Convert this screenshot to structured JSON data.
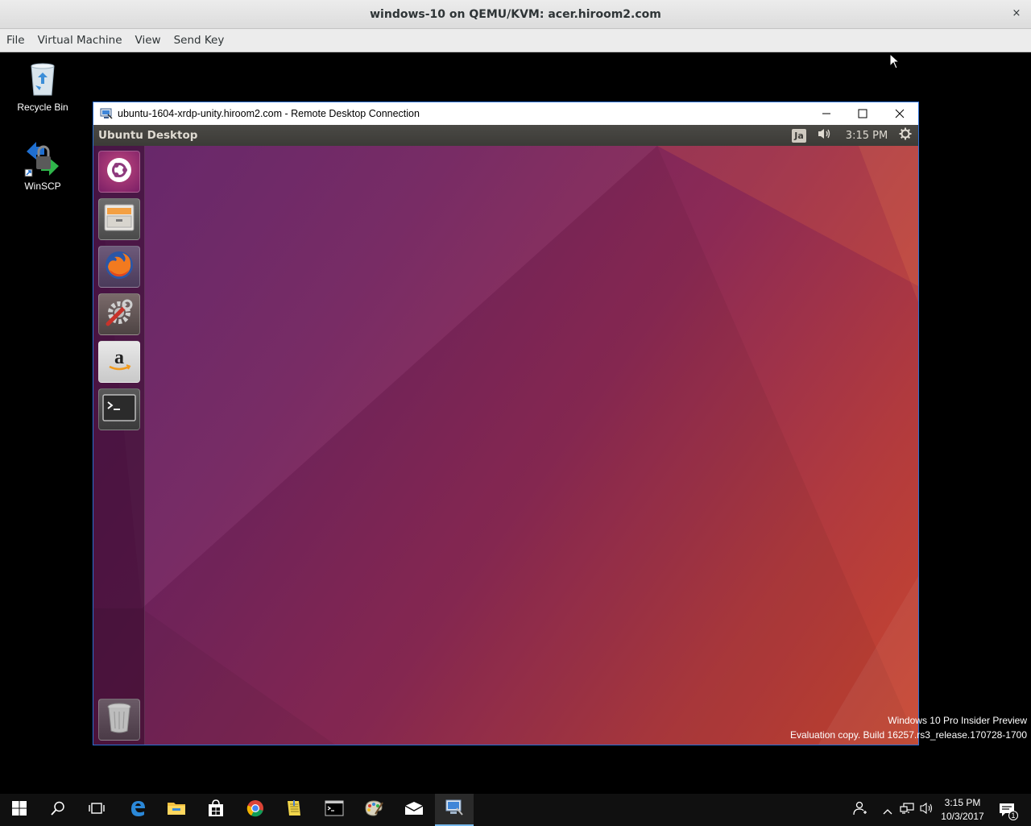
{
  "host": {
    "title": "windows-10 on QEMU/KVM: acer.hiroom2.com",
    "close_glyph": "×",
    "menu": [
      "File",
      "Virtual Machine",
      "View",
      "Send Key"
    ]
  },
  "desktop": {
    "icons": [
      {
        "label": "Recycle Bin",
        "icon": "recycle-bin-icon"
      },
      {
        "label": "WinSCP",
        "icon": "winscp-icon"
      }
    ],
    "watermark": {
      "line1": "Windows 10 Pro Insider Preview",
      "line2": "Evaluation copy. Build 16257.rs3_release.170728-1700"
    }
  },
  "rdp_window": {
    "title": "ubuntu-1604-xrdp-unity.hiroom2.com - Remote Desktop Connection",
    "controls": [
      "minimize-icon",
      "maximize-icon",
      "close-icon"
    ]
  },
  "ubuntu": {
    "panel_title": "Ubuntu Desktop",
    "indicators": {
      "language": "Ja",
      "clock": "3:15 PM"
    },
    "launcher": [
      "ubuntu-dash-icon",
      "files-icon",
      "firefox-icon",
      "system-settings-icon",
      "amazon-icon",
      "terminal-icon",
      "trash-icon"
    ]
  },
  "taskbar": {
    "items": [
      "start-icon",
      "search-icon",
      "task-view-icon",
      "edge-icon",
      "file-explorer-icon",
      "store-icon",
      "chrome-icon",
      "notepad-icon",
      "command-prompt-icon",
      "paint-icon",
      "mail-icon",
      "remote-desktop-icon"
    ],
    "tray": {
      "time": "3:15 PM",
      "date": "10/3/2017",
      "notification_count": "1"
    }
  },
  "colors": {
    "rdp_border": "#2b6fd6",
    "ubuntu_panel": "#3c3b37",
    "taskbar": "#101010",
    "active_task_underline": "#76b9ed"
  }
}
